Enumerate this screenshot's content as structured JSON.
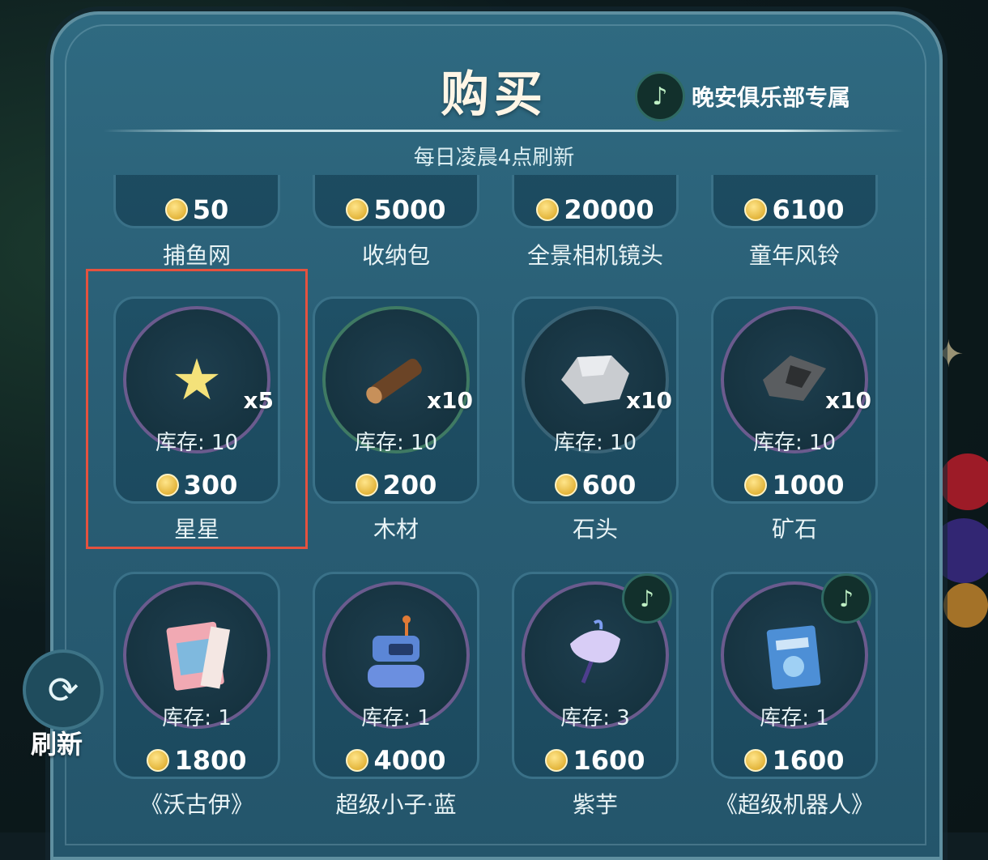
{
  "header": {
    "title": "购买",
    "club_label": "晚安俱乐部专属",
    "club_icon": "music-note-icon",
    "refresh_note": "每日凌晨4点刷新"
  },
  "currency_icon": "gold-coin-icon",
  "colors": {
    "panel": "#2a5f76",
    "highlight": "#e4523f",
    "coin": "#e3b53b"
  },
  "items_top_row": [
    {
      "name": "捕鱼网",
      "price": "50"
    },
    {
      "name": "收纳包",
      "price": "5000"
    },
    {
      "name": "全景相机镜头",
      "price": "20000"
    },
    {
      "name": "童年风铃",
      "price": "6100"
    }
  ],
  "items_row2": [
    {
      "name": "星星",
      "price": "300",
      "stock": "库存: 10",
      "qty": "x5",
      "icon": "star-icon"
    },
    {
      "name": "木材",
      "price": "200",
      "stock": "库存: 10",
      "qty": "x10",
      "icon": "wood-log-icon"
    },
    {
      "name": "石头",
      "price": "600",
      "stock": "库存: 10",
      "qty": "x10",
      "icon": "stone-icon"
    },
    {
      "name": "矿石",
      "price": "1000",
      "stock": "库存: 10",
      "qty": "x10",
      "icon": "ore-icon"
    }
  ],
  "items_row3": [
    {
      "name": "《沃古伊》",
      "price": "1800",
      "stock": "库存: 1",
      "icon": "magazine-icon"
    },
    {
      "name": "超级小子·蓝",
      "price": "4000",
      "stock": "库存: 1",
      "icon": "robot-toy-icon"
    },
    {
      "name": "紫芋",
      "price": "1600",
      "stock": "库存: 3",
      "icon": "purple-taro-icon",
      "club_exclusive": true
    },
    {
      "name": "《超级机器人》",
      "price": "1600",
      "stock": "库存: 1",
      "icon": "robot-book-icon",
      "club_exclusive": true
    }
  ],
  "sidebar": {
    "refresh_label": "刷新",
    "refresh_icon": "refresh-icon"
  }
}
